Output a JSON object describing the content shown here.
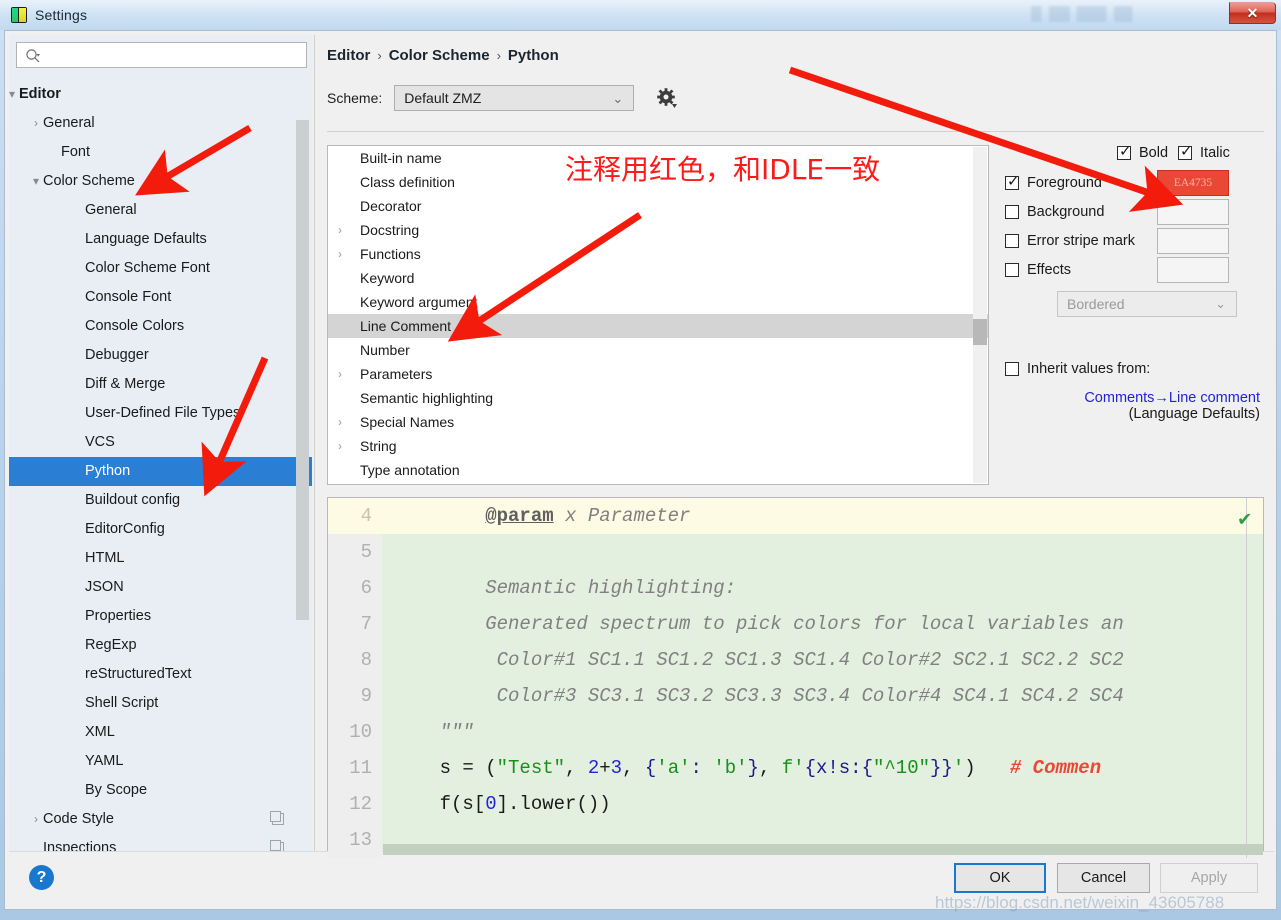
{
  "window": {
    "title": "Settings",
    "icon": "pycharm-icon",
    "close_label": "✕"
  },
  "search": {
    "placeholder": "",
    "value": "",
    "icon": "search-icon"
  },
  "sidebar": {
    "items": [
      {
        "label": "Editor",
        "indent": 10,
        "twisty": "▾",
        "bold": true,
        "selected": false,
        "copy": false
      },
      {
        "label": "General",
        "indent": 34,
        "twisty": "›",
        "bold": false,
        "selected": false,
        "copy": false
      },
      {
        "label": "Font",
        "indent": 52,
        "twisty": "",
        "bold": false,
        "selected": false,
        "copy": false
      },
      {
        "label": "Color Scheme",
        "indent": 34,
        "twisty": "▾",
        "bold": false,
        "selected": false,
        "copy": false
      },
      {
        "label": "General",
        "indent": 76,
        "twisty": "",
        "bold": false,
        "selected": false,
        "copy": false
      },
      {
        "label": "Language Defaults",
        "indent": 76,
        "twisty": "",
        "bold": false,
        "selected": false,
        "copy": false
      },
      {
        "label": "Color Scheme Font",
        "indent": 76,
        "twisty": "",
        "bold": false,
        "selected": false,
        "copy": false
      },
      {
        "label": "Console Font",
        "indent": 76,
        "twisty": "",
        "bold": false,
        "selected": false,
        "copy": false
      },
      {
        "label": "Console Colors",
        "indent": 76,
        "twisty": "",
        "bold": false,
        "selected": false,
        "copy": false
      },
      {
        "label": "Debugger",
        "indent": 76,
        "twisty": "",
        "bold": false,
        "selected": false,
        "copy": false
      },
      {
        "label": "Diff & Merge",
        "indent": 76,
        "twisty": "",
        "bold": false,
        "selected": false,
        "copy": false
      },
      {
        "label": "User-Defined File Types",
        "indent": 76,
        "twisty": "",
        "bold": false,
        "selected": false,
        "copy": false
      },
      {
        "label": "VCS",
        "indent": 76,
        "twisty": "",
        "bold": false,
        "selected": false,
        "copy": false
      },
      {
        "label": "Python",
        "indent": 76,
        "twisty": "",
        "bold": false,
        "selected": true,
        "copy": false
      },
      {
        "label": "Buildout config",
        "indent": 76,
        "twisty": "",
        "bold": false,
        "selected": false,
        "copy": false
      },
      {
        "label": "EditorConfig",
        "indent": 76,
        "twisty": "",
        "bold": false,
        "selected": false,
        "copy": false
      },
      {
        "label": "HTML",
        "indent": 76,
        "twisty": "",
        "bold": false,
        "selected": false,
        "copy": false
      },
      {
        "label": "JSON",
        "indent": 76,
        "twisty": "",
        "bold": false,
        "selected": false,
        "copy": false
      },
      {
        "label": "Properties",
        "indent": 76,
        "twisty": "",
        "bold": false,
        "selected": false,
        "copy": false
      },
      {
        "label": "RegExp",
        "indent": 76,
        "twisty": "",
        "bold": false,
        "selected": false,
        "copy": false
      },
      {
        "label": "reStructuredText",
        "indent": 76,
        "twisty": "",
        "bold": false,
        "selected": false,
        "copy": false
      },
      {
        "label": "Shell Script",
        "indent": 76,
        "twisty": "",
        "bold": false,
        "selected": false,
        "copy": false
      },
      {
        "label": "XML",
        "indent": 76,
        "twisty": "",
        "bold": false,
        "selected": false,
        "copy": false
      },
      {
        "label": "YAML",
        "indent": 76,
        "twisty": "",
        "bold": false,
        "selected": false,
        "copy": false
      },
      {
        "label": "By Scope",
        "indent": 76,
        "twisty": "",
        "bold": false,
        "selected": false,
        "copy": false
      },
      {
        "label": "Code Style",
        "indent": 34,
        "twisty": "›",
        "bold": false,
        "selected": false,
        "copy": true
      },
      {
        "label": "Inspections",
        "indent": 34,
        "twisty": "",
        "bold": false,
        "selected": false,
        "copy": true
      }
    ]
  },
  "breadcrumb": {
    "parts": [
      "Editor",
      "Color Scheme",
      "Python"
    ],
    "separator": "›"
  },
  "scheme": {
    "label": "Scheme:",
    "value": "Default ZMZ",
    "arrow": "⌄",
    "gear_icon": "gear-icon"
  },
  "keylist": {
    "items": [
      {
        "label": "Built-in name",
        "twisty": "",
        "highlighted": false
      },
      {
        "label": "Class definition",
        "twisty": "",
        "highlighted": false
      },
      {
        "label": "Decorator",
        "twisty": "",
        "highlighted": false
      },
      {
        "label": "Docstring",
        "twisty": "›",
        "highlighted": false
      },
      {
        "label": "Functions",
        "twisty": "›",
        "highlighted": false
      },
      {
        "label": "Keyword",
        "twisty": "",
        "highlighted": false
      },
      {
        "label": "Keyword argument",
        "twisty": "",
        "highlighted": false
      },
      {
        "label": "Line Comment",
        "twisty": "",
        "highlighted": true
      },
      {
        "label": "Number",
        "twisty": "",
        "highlighted": false
      },
      {
        "label": "Parameters",
        "twisty": "›",
        "highlighted": false
      },
      {
        "label": "Semantic highlighting",
        "twisty": "",
        "highlighted": false
      },
      {
        "label": "Special Names",
        "twisty": "›",
        "highlighted": false
      },
      {
        "label": "String",
        "twisty": "›",
        "highlighted": false
      },
      {
        "label": "Type annotation",
        "twisty": "",
        "highlighted": false
      }
    ]
  },
  "options": {
    "bold": {
      "label": "Bold",
      "checked": true
    },
    "italic": {
      "label": "Italic",
      "checked": true
    },
    "rows": [
      {
        "label": "Foreground",
        "checked": true,
        "swatch": "EA4735",
        "color": "#ea4735"
      },
      {
        "label": "Background",
        "checked": false,
        "swatch": "",
        "color": ""
      },
      {
        "label": "Error stripe mark",
        "checked": false,
        "swatch": "",
        "color": ""
      },
      {
        "label": "Effects",
        "checked": false,
        "swatch": "",
        "color": ""
      }
    ],
    "effect_type": {
      "value": "Bordered",
      "arrow": "⌄"
    },
    "inherit": {
      "label": "Inherit values from:",
      "checked": false,
      "link": "Comments→Line comment",
      "sub": "(Language Defaults)"
    }
  },
  "preview": {
    "check_icon": "validation-ok-icon",
    "lines": [
      {
        "num": "4",
        "current": true,
        "tokens": [
          {
            "t": "        ",
            "c": "plain"
          },
          {
            "t": "@param",
            "c": "tag"
          },
          {
            "t": " x Parameter",
            "c": "doc"
          }
        ]
      },
      {
        "num": "5",
        "current": false,
        "tokens": []
      },
      {
        "num": "6",
        "current": false,
        "tokens": [
          {
            "t": "        Semantic highlighting:",
            "c": "doc"
          }
        ]
      },
      {
        "num": "7",
        "current": false,
        "tokens": [
          {
            "t": "        Generated spectrum to pick colors for local variables an",
            "c": "doc"
          }
        ]
      },
      {
        "num": "8",
        "current": false,
        "tokens": [
          {
            "t": "         Color#1 SC1.1 SC1.2 SC1.3 SC1.4 Color#2 SC2.1 SC2.2 SC2",
            "c": "doc"
          }
        ]
      },
      {
        "num": "9",
        "current": false,
        "tokens": [
          {
            "t": "         Color#3 SC3.1 SC3.2 SC3.3 SC3.4 Color#4 SC4.1 SC4.2 SC4",
            "c": "doc"
          }
        ]
      },
      {
        "num": "10",
        "current": false,
        "tokens": [
          {
            "t": "    ",
            "c": "plain"
          },
          {
            "t": "\"\"\"",
            "c": "doc"
          }
        ]
      },
      {
        "num": "11",
        "current": false,
        "tokens": [
          {
            "t": "    s = (",
            "c": "plain"
          },
          {
            "t": "\"Test\"",
            "c": "str"
          },
          {
            "t": ", ",
            "c": "plain"
          },
          {
            "t": "2",
            "c": "num"
          },
          {
            "t": "+",
            "c": "plain"
          },
          {
            "t": "3",
            "c": "num"
          },
          {
            "t": ", ",
            "c": "plain"
          },
          {
            "t": "{",
            "c": "brace"
          },
          {
            "t": "'a'",
            "c": "str"
          },
          {
            "t": ": ",
            "c": "brace"
          },
          {
            "t": "'b'",
            "c": "str"
          },
          {
            "t": "}",
            "c": "brace"
          },
          {
            "t": ", ",
            "c": "plain"
          },
          {
            "t": "f",
            "c": "fstr"
          },
          {
            "t": "'",
            "c": "str"
          },
          {
            "t": "{x!s:{",
            "c": "brace"
          },
          {
            "t": "\"",
            "c": "str"
          },
          {
            "t": "^10",
            "c": "str"
          },
          {
            "t": "\"",
            "c": "str"
          },
          {
            "t": "}}",
            "c": "brace"
          },
          {
            "t": "'",
            "c": "str"
          },
          {
            "t": ")",
            "c": "plain"
          },
          {
            "t": "   ",
            "c": "plain"
          },
          {
            "t": "# Commen",
            "c": "cmt"
          }
        ]
      },
      {
        "num": "12",
        "current": false,
        "tokens": [
          {
            "t": "    f(s[",
            "c": "plain"
          },
          {
            "t": "0",
            "c": "num"
          },
          {
            "t": "].lower())",
            "c": "plain"
          }
        ]
      },
      {
        "num": "13",
        "current": false,
        "tokens": []
      }
    ]
  },
  "footer": {
    "help_icon": "help-icon",
    "help_label": "?",
    "ok": "OK",
    "cancel": "Cancel",
    "apply": "Apply"
  },
  "annotations": {
    "note_cn": "注释用红色，和IDLE一致",
    "arrow_color": "#f31b0b",
    "watermark": "https://blog.csdn.net/weixin_43605788"
  }
}
